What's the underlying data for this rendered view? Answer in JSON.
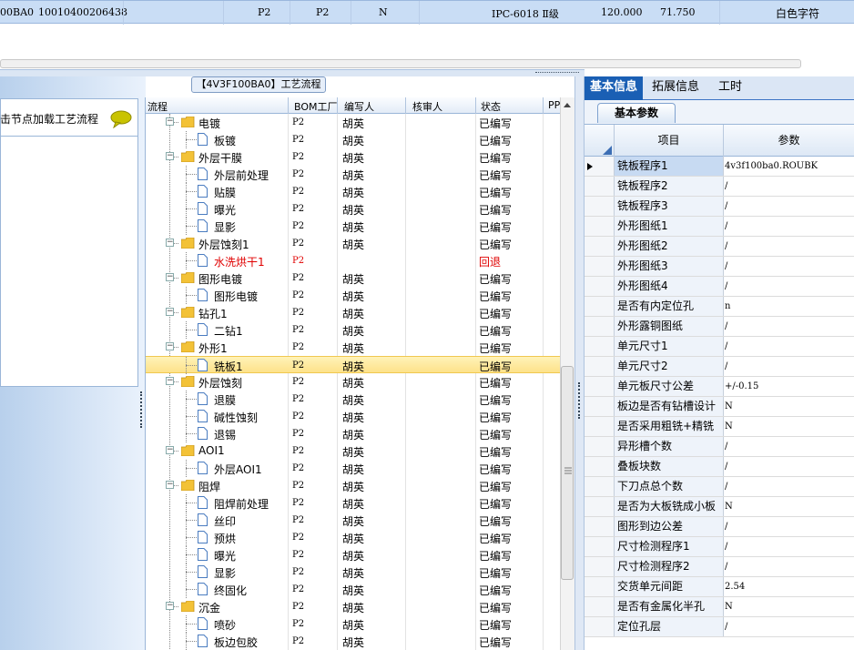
{
  "top_row": {
    "code": "00BA0",
    "number": "10010400206438",
    "c1": "P2",
    "c2": "P2",
    "c3": "N",
    "spec": "IPC-6018 Ⅱ级",
    "v1": "120.000",
    "v2": "71.750",
    "mark": "白色字符"
  },
  "left": {
    "header_text": "击节点加载工艺流程"
  },
  "process": {
    "title": "【4V3F100BA0】工艺流程",
    "columns": [
      "流程",
      "BOM工厂",
      "编写人",
      "核审人",
      "状态",
      "PP"
    ],
    "rows": [
      {
        "level": 0,
        "name": "电镀",
        "bom": "P2",
        "writer": "胡英",
        "status": "已编写"
      },
      {
        "level": 1,
        "name": "板镀",
        "bom": "P2",
        "writer": "胡英",
        "status": "已编写"
      },
      {
        "level": 0,
        "name": "外层干膜",
        "bom": "P2",
        "writer": "胡英",
        "status": "已编写"
      },
      {
        "level": 1,
        "name": "外层前处理",
        "bom": "P2",
        "writer": "胡英",
        "status": "已编写"
      },
      {
        "level": 1,
        "name": "贴膜",
        "bom": "P2",
        "writer": "胡英",
        "status": "已编写"
      },
      {
        "level": 1,
        "name": "曝光",
        "bom": "P2",
        "writer": "胡英",
        "status": "已编写"
      },
      {
        "level": 1,
        "name": "显影",
        "bom": "P2",
        "writer": "胡英",
        "status": "已编写"
      },
      {
        "level": 0,
        "name": "外层蚀刻1",
        "bom": "P2",
        "writer": "胡英",
        "status": "已编写"
      },
      {
        "level": 1,
        "name": "水洗烘干1",
        "bom": "P2",
        "writer": "",
        "status": "回退",
        "red": true
      },
      {
        "level": 0,
        "name": "图形电镀",
        "bom": "P2",
        "writer": "胡英",
        "status": "已编写"
      },
      {
        "level": 1,
        "name": "图形电镀",
        "bom": "P2",
        "writer": "胡英",
        "status": "已编写"
      },
      {
        "level": 0,
        "name": "钻孔1",
        "bom": "P2",
        "writer": "胡英",
        "status": "已编写"
      },
      {
        "level": 1,
        "name": "二钻1",
        "bom": "P2",
        "writer": "胡英",
        "status": "已编写"
      },
      {
        "level": 0,
        "name": "外形1",
        "bom": "P2",
        "writer": "胡英",
        "status": "已编写"
      },
      {
        "level": 1,
        "name": "铣板1",
        "bom": "P2",
        "writer": "胡英",
        "status": "已编写",
        "selected": true
      },
      {
        "level": 0,
        "name": "外层蚀刻",
        "bom": "P2",
        "writer": "胡英",
        "status": "已编写"
      },
      {
        "level": 1,
        "name": "退膜",
        "bom": "P2",
        "writer": "胡英",
        "status": "已编写"
      },
      {
        "level": 1,
        "name": "碱性蚀刻",
        "bom": "P2",
        "writer": "胡英",
        "status": "已编写"
      },
      {
        "level": 1,
        "name": "退锡",
        "bom": "P2",
        "writer": "胡英",
        "status": "已编写"
      },
      {
        "level": 0,
        "name": "AOI1",
        "bom": "P2",
        "writer": "胡英",
        "status": "已编写"
      },
      {
        "level": 1,
        "name": "外层AOI1",
        "bom": "P2",
        "writer": "胡英",
        "status": "已编写"
      },
      {
        "level": 0,
        "name": "阻焊",
        "bom": "P2",
        "writer": "胡英",
        "status": "已编写"
      },
      {
        "level": 1,
        "name": "阻焊前处理",
        "bom": "P2",
        "writer": "胡英",
        "status": "已编写"
      },
      {
        "level": 1,
        "name": "丝印",
        "bom": "P2",
        "writer": "胡英",
        "status": "已编写"
      },
      {
        "level": 1,
        "name": "预烘",
        "bom": "P2",
        "writer": "胡英",
        "status": "已编写"
      },
      {
        "level": 1,
        "name": "曝光",
        "bom": "P2",
        "writer": "胡英",
        "status": "已编写"
      },
      {
        "level": 1,
        "name": "显影",
        "bom": "P2",
        "writer": "胡英",
        "status": "已编写"
      },
      {
        "level": 1,
        "name": "终固化",
        "bom": "P2",
        "writer": "胡英",
        "status": "已编写"
      },
      {
        "level": 0,
        "name": "沉金",
        "bom": "P2",
        "writer": "胡英",
        "status": "已编写"
      },
      {
        "level": 1,
        "name": "喷砂",
        "bom": "P2",
        "writer": "胡英",
        "status": "已编写"
      },
      {
        "level": 1,
        "name": "板边包胶",
        "bom": "P2",
        "writer": "胡英",
        "status": "已编写"
      }
    ]
  },
  "right": {
    "tabs": [
      "基本信息",
      "拓展信息",
      "工时"
    ],
    "subtab": "基本参数",
    "col_item": "项目",
    "col_param": "参数",
    "params": [
      {
        "key": "铣板程序1",
        "value": "4v3f100ba0.ROUBK",
        "selected": true
      },
      {
        "key": "铣板程序2",
        "value": "/"
      },
      {
        "key": "铣板程序3",
        "value": "/"
      },
      {
        "key": "外形图纸1",
        "value": "/"
      },
      {
        "key": "外形图纸2",
        "value": "/"
      },
      {
        "key": "外形图纸3",
        "value": "/"
      },
      {
        "key": "外形图纸4",
        "value": "/"
      },
      {
        "key": "是否有内定位孔",
        "value": "n"
      },
      {
        "key": "外形露铜图纸",
        "value": "/"
      },
      {
        "key": "单元尺寸1",
        "value": "/"
      },
      {
        "key": "单元尺寸2",
        "value": "/"
      },
      {
        "key": "单元板尺寸公差",
        "value": "+/-0.15"
      },
      {
        "key": "板边是否有钻槽设计",
        "value": "N"
      },
      {
        "key": "是否采用粗铣+精铣",
        "value": "N"
      },
      {
        "key": "异形槽个数",
        "value": "/"
      },
      {
        "key": "叠板块数",
        "value": "/"
      },
      {
        "key": "下刀点总个数",
        "value": "/"
      },
      {
        "key": "是否为大板铣成小板",
        "value": "N"
      },
      {
        "key": "图形到边公差",
        "value": "/"
      },
      {
        "key": "尺寸检测程序1",
        "value": "/"
      },
      {
        "key": "尺寸检测程序2",
        "value": "/"
      },
      {
        "key": "交货单元间距",
        "value": "2.54"
      },
      {
        "key": "是否有金属化半孔",
        "value": "N"
      },
      {
        "key": "定位孔层",
        "value": "/"
      }
    ]
  },
  "colors": {
    "selected_row": "#fde28a",
    "tab_active": "#1a5fb4",
    "rejected_text": "#e00000",
    "folder": "#f3c237"
  }
}
